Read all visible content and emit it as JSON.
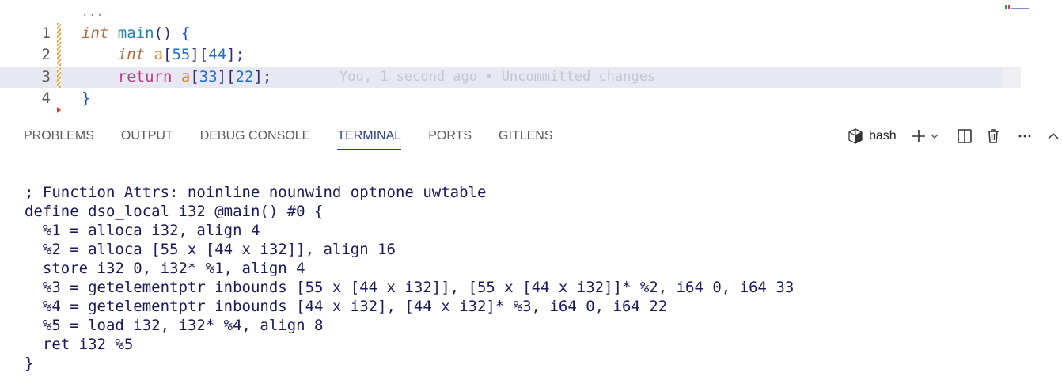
{
  "editor": {
    "fold_ellipsis": "...",
    "lines": [
      {
        "number": "1",
        "tokens": [
          {
            "text": "int",
            "cls": "kw-type"
          },
          {
            "text": " ",
            "cls": ""
          },
          {
            "text": "main",
            "cls": "fn"
          },
          {
            "text": "()",
            "cls": "punc"
          },
          {
            "text": " ",
            "cls": ""
          },
          {
            "text": "{",
            "cls": "brace"
          }
        ]
      },
      {
        "number": "2",
        "tokens": [
          {
            "text": "    ",
            "cls": ""
          },
          {
            "text": "int",
            "cls": "kw-type"
          },
          {
            "text": " ",
            "cls": ""
          },
          {
            "text": "a",
            "cls": "var"
          },
          {
            "text": "[",
            "cls": "punc"
          },
          {
            "text": "55",
            "cls": "num"
          },
          {
            "text": "][",
            "cls": "punc"
          },
          {
            "text": "44",
            "cls": "num"
          },
          {
            "text": "];",
            "cls": "punc"
          }
        ]
      },
      {
        "number": "3",
        "current": true,
        "tokens": [
          {
            "text": "    ",
            "cls": ""
          },
          {
            "text": "return",
            "cls": "kw-ctrl"
          },
          {
            "text": " ",
            "cls": ""
          },
          {
            "text": "a",
            "cls": "var"
          },
          {
            "text": "[",
            "cls": "punc"
          },
          {
            "text": "33",
            "cls": "num"
          },
          {
            "text": "][",
            "cls": "punc"
          },
          {
            "text": "22",
            "cls": "num"
          },
          {
            "text": "];",
            "cls": "punc"
          }
        ]
      },
      {
        "number": "4",
        "tokens": [
          {
            "text": "}",
            "cls": "brace"
          }
        ]
      }
    ],
    "blame": "You, 1 second ago • Uncommitted changes"
  },
  "panel": {
    "tabs": [
      {
        "label": "PROBLEMS",
        "active": false
      },
      {
        "label": "OUTPUT",
        "active": false
      },
      {
        "label": "DEBUG CONSOLE",
        "active": false
      },
      {
        "label": "TERMINAL",
        "active": true
      },
      {
        "label": "PORTS",
        "active": false
      },
      {
        "label": "GITLENS",
        "active": false
      }
    ],
    "shell_name": "bash",
    "icons": {
      "shell": "terminal-icon",
      "new": "plus-icon",
      "dropdown": "chevron-down-icon",
      "split": "split-icon",
      "trash": "trash-icon",
      "more": "ellipsis-icon",
      "maximize": "chevron-up-icon"
    }
  },
  "terminal": {
    "output": "; Function Attrs: noinline nounwind optnone uwtable\ndefine dso_local i32 @main() #0 {\n  %1 = alloca i32, align 4\n  %2 = alloca [55 x [44 x i32]], align 16\n  store i32 0, i32* %1, align 4\n  %3 = getelementptr inbounds [55 x [44 x i32]], [55 x [44 x i32]]* %2, i64 0, i64 33\n  %4 = getelementptr inbounds [44 x i32], [44 x i32]* %3, i64 0, i64 22\n  %5 = load i32, i32* %4, align 8\n  ret i32 %5\n}"
  },
  "colors": {
    "accent": "#2a3e8c",
    "current_line": "#e8e8f2"
  }
}
